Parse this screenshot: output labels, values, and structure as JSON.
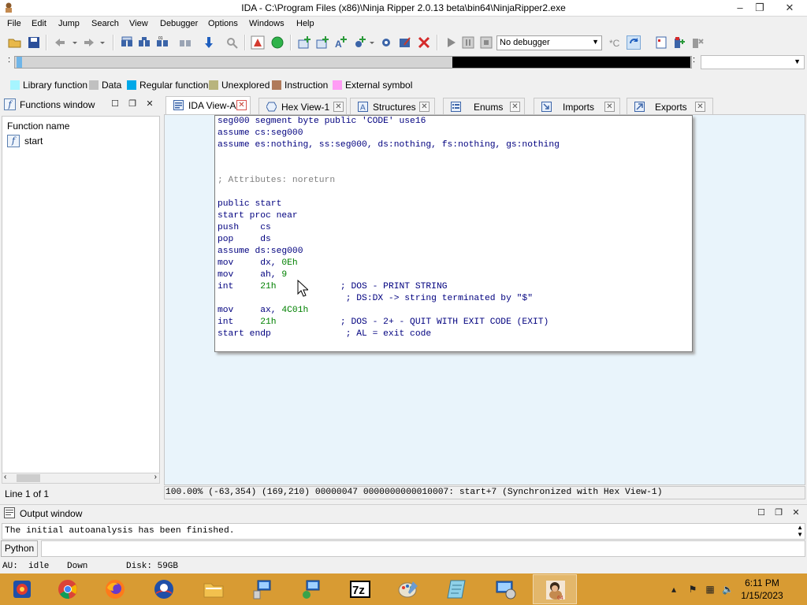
{
  "window": {
    "title": "IDA - C:\\Program Files (x86)\\Ninja Ripper 2.0.13 beta\\bin64\\NinjaRipper2.exe",
    "controls": [
      "–",
      "❐",
      "✕"
    ]
  },
  "menu": [
    "File",
    "Edit",
    "Jump",
    "Search",
    "View",
    "Debugger",
    "Options",
    "Windows",
    "Help"
  ],
  "toolbar": {
    "debugger_select_value": "No debugger"
  },
  "legend": [
    {
      "label": "Library function",
      "color": "#a6f5ff"
    },
    {
      "label": "Data",
      "color": "#c0c0c0"
    },
    {
      "label": "Regular function",
      "color": "#00a8e8"
    },
    {
      "label": "Unexplored",
      "color": "#b8b47d"
    },
    {
      "label": "Instruction",
      "color": "#b07a5a"
    },
    {
      "label": "External symbol",
      "color": "#ff9cf5"
    }
  ],
  "functions_window": {
    "title": "Functions window",
    "column_header": "Function name",
    "items": [
      "start"
    ],
    "status": "Line 1 of 1"
  },
  "tabs": [
    {
      "label": "IDA View-A",
      "icon": "ida-view-icon",
      "active": true
    },
    {
      "label": "Hex View-1",
      "icon": "hex-view-icon",
      "active": false
    },
    {
      "label": "Structures",
      "icon": "structures-icon",
      "active": false
    },
    {
      "label": "Enums",
      "icon": "enums-icon",
      "active": false
    },
    {
      "label": "Imports",
      "icon": "imports-icon",
      "active": false
    },
    {
      "label": "Exports",
      "icon": "exports-icon",
      "active": false
    }
  ],
  "listing": [
    {
      "text": "seg000 segment byte public 'CODE' use16",
      "style": "normal"
    },
    {
      "text": "assume cs:seg000",
      "style": "normal"
    },
    {
      "text": "assume es:nothing, ss:seg000, ds:nothing, fs:nothing, gs:nothing",
      "style": "normal"
    },
    {
      "text": "",
      "style": "normal"
    },
    {
      "text": "",
      "style": "normal"
    },
    {
      "text": "; Attributes: noreturn",
      "style": "grey"
    },
    {
      "text": "",
      "style": "normal"
    },
    {
      "text": "public start",
      "style": "normal"
    },
    {
      "text": "start proc near",
      "style": "normal"
    },
    {
      "text": "push    cs",
      "style": "normal"
    },
    {
      "text": "pop     ds",
      "style": "normal"
    },
    {
      "text": "assume ds:seg000",
      "style": "normal"
    },
    {
      "text": "mov     dx, ",
      "num": "0Eh",
      "style": "normal"
    },
    {
      "text": "mov     ah, ",
      "num": "9",
      "style": "normal"
    },
    {
      "text": "int     ",
      "num": "21h",
      "comment": "            ; DOS - PRINT STRING",
      "style": "normal"
    },
    {
      "text": "                        ; DS:DX -> string terminated by \"$\"",
      "style": "normal"
    },
    {
      "text": "mov     ax, ",
      "num": "4C01h",
      "style": "normal"
    },
    {
      "text": "int     ",
      "num": "21h",
      "comment": "            ; DOS - 2+ - QUIT WITH EXIT CODE (EXIT)",
      "style": "normal"
    },
    {
      "text": "start endp              ; AL = exit code",
      "style": "normal"
    }
  ],
  "ida_status": "100.00% (-63,354) (169,210) 00000047 0000000000010007: start+7 (Synchronized with Hex View-1)",
  "output_window": {
    "title": "Output window",
    "message": "The initial autoanalysis has been finished.",
    "python_button": "Python"
  },
  "au_status": {
    "au": "AU:  idle",
    "direction": "Down",
    "disk": "Disk: 59GB"
  },
  "taskbar": {
    "apps": [
      "ninja-ripper-icon",
      "chrome-icon",
      "firefox-icon",
      "obama-icon",
      "file-explorer-icon",
      "network-computer-icon",
      "network-drive-icon",
      "7zip-icon",
      "paint-icon",
      "notepad-icon",
      "remote-desktop-icon",
      "ida-icon"
    ],
    "time": "6:11 PM",
    "date": "1/15/2023"
  }
}
